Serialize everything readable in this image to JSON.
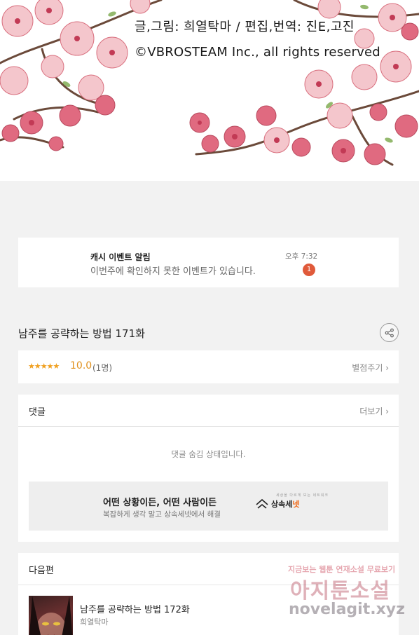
{
  "banner": {
    "credit_line1": "글,그림: 희열탁마 / 편집,번역: 진E,고진",
    "credit_line2": "©VBROSTEAM Inc., all rights reserved"
  },
  "notification": {
    "title": "캐시 이벤트 알림",
    "body": "이번주에 확인하지 못한 이벤트가 있습니다.",
    "time": "오후 7:32",
    "badge": "1"
  },
  "episode": {
    "title": "남주를 공략하는 방법 171화"
  },
  "rating": {
    "stars": "★★★★★",
    "score": "10.0",
    "count": "(1명)",
    "rate_label": "별점주기 ›"
  },
  "comments": {
    "heading": "댓글",
    "more_label": "더보기 ›",
    "hidden_message": "댓글 숨김 상태입니다.",
    "ad": {
      "title": "어떤 상황이든, 어떤 사람이든",
      "subtitle": "복잡하게 생각 말고 상속세넷에서 해결",
      "logo_text_a": "상속세",
      "logo_text_b": "넷",
      "logo_tag": "세상을 다르게 보는 네트워크"
    }
  },
  "next": {
    "heading": "다음편",
    "title": "남주를 공략하는 방법 172화",
    "author": "희열탁마"
  },
  "watermark": {
    "line1": "지금보는 웹툰 연재소설 무료보기",
    "line2": "아지툰소설",
    "line3": "novelagit.xyz"
  },
  "colors": {
    "accent_orange": "#e0901c",
    "badge_red": "#e05a3a",
    "blossom": "#e8788a"
  }
}
